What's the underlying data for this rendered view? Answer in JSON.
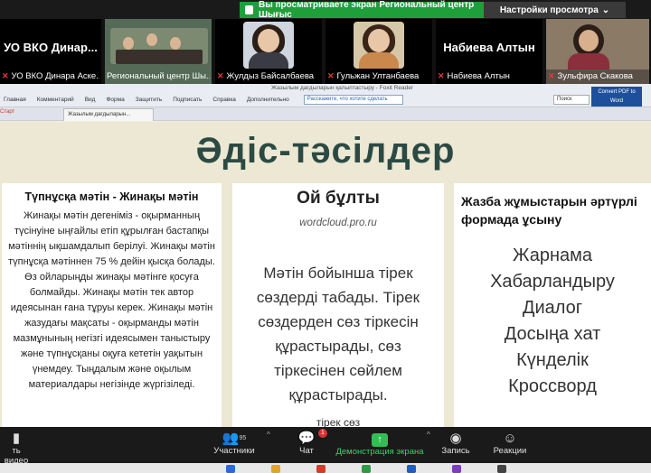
{
  "share_banner": {
    "text": "Вы просматриваете экран Региональный центр Шығыс",
    "settings_label": "Настройки просмотра",
    "settings_caret": "⌄"
  },
  "participants": [
    {
      "big_name": "УО ВКО  Динар...",
      "label": "УО ВКО  Динара Аске..."
    },
    {
      "big_name": "",
      "label": "Региональный центр Шы..."
    },
    {
      "big_name": "",
      "label": "Жулдыз Байсалбаева"
    },
    {
      "big_name": "",
      "label": "Гульжан Ултанбаева"
    },
    {
      "big_name": "Набиева Алтын",
      "label": "Набиева Алтын"
    },
    {
      "big_name": "",
      "label": "Зульфира Скакова"
    }
  ],
  "viewer": {
    "window_title": "Жазылым дағдыларын қалыптастыру - Foxit Reader",
    "menu": [
      "Главная",
      "Комментарий",
      "Вид",
      "Форма",
      "Защитить",
      "Подписать",
      "Справка",
      "Дополнительно"
    ],
    "search_placeholder": "Расскажите, что хотите сделать",
    "find_value": "Поиск",
    "convert_label": "Convert PDF to Word",
    "tab_label": "Жазылым дағдыларын...",
    "tab_prev": "Старт"
  },
  "slide": {
    "title": "Әдіс-тәсілдер",
    "col1": {
      "heading": "Түпнұсқа мәтін - Жинақы мәтін",
      "body": "Жинақы мәтін дегеніміз - оқырманның түсінуіне ыңғайлы етіп құрылған бастапқы мәтіннің ықшамдалып берілуі. Жинақы мәтін түпнұсқа мәтіннен 75 % дейін қысқа болады. Өз ойларыңды жинақы мәтінге қосуға болмайды. Жинақы мәтін тек автор идеясынан ғана тұруы керек. Жинақы мәтін жазудағы мақсаты - оқырманды мәтін мазмұнының негізгі идеясымен таныстыру және түпнұсқаны оқуға кететін уақытын үнемдеу. Тыңдалым және оқылым материалдары негізінде жүргізіледі."
    },
    "col2": {
      "heading": "Ой бұлты",
      "sub": "wordcloud.pro.ru",
      "text": "Мәтін бойынша тірек сөздерді табады. Тірек сөздерден сөз тіркесін құрастырады, сөз тіркесінен сөйлем құрастырады.",
      "cut": "тірек сөз"
    },
    "col3": {
      "heading": "Жазба жұмыстарын әртүрлі формада ұсыну",
      "items": [
        "Жарнама",
        "Хабарландыру",
        "Диалог",
        "Досыңа хат",
        "Күнделік",
        "Кроссворд"
      ]
    }
  },
  "zoom_bar": {
    "video_label": "ть видео",
    "participants_label": "Участники",
    "participants_count": "95",
    "chat_label": "Чат",
    "chat_badge": "1",
    "share_label": "Демонстрация экрана",
    "record_label": "Запись",
    "reactions_label": "Реакции"
  },
  "colors": {
    "accent_green": "#1f9f3a",
    "slide_title": "#2c4a44",
    "slide_bg": "#ece8d3"
  }
}
